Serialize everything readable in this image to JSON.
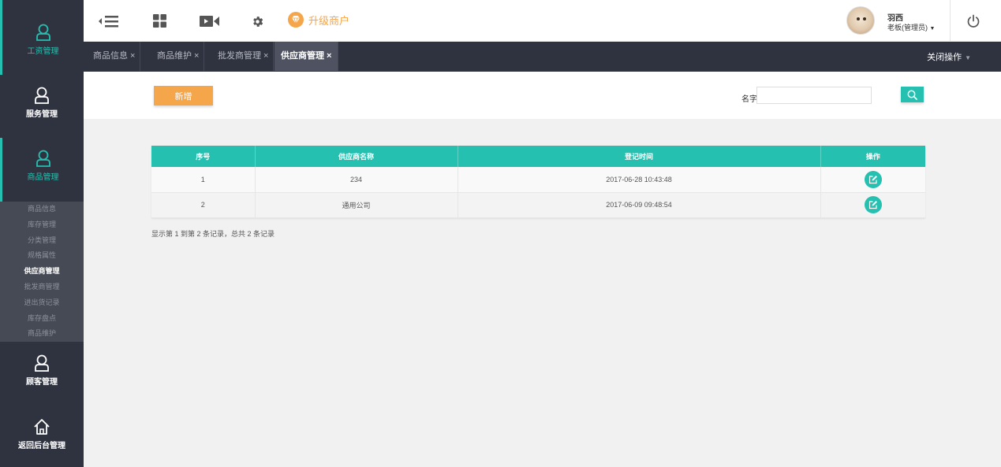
{
  "sidebar": {
    "items": [
      {
        "label": "工资管理",
        "icon": "user-icon"
      },
      {
        "label": "服务管理",
        "icon": "user-icon"
      },
      {
        "label": "商品管理",
        "icon": "user-icon"
      },
      {
        "label": "顾客管理",
        "icon": "user-icon"
      },
      {
        "label": "返回后台管理",
        "icon": "home-icon"
      }
    ],
    "submenu": [
      {
        "label": "商品信息"
      },
      {
        "label": "库存管理"
      },
      {
        "label": "分类管理"
      },
      {
        "label": "规格属性"
      },
      {
        "label": "供应商管理"
      },
      {
        "label": "批发商管理"
      },
      {
        "label": "进出货记录"
      },
      {
        "label": "库存盘点"
      },
      {
        "label": "商品维护"
      }
    ]
  },
  "header": {
    "upgrade_label": "升级商户",
    "user_name": "羽西",
    "user_role": "老板(管理员)",
    "icons": [
      "menu-collapse-icon",
      "grid-icon",
      "video-icon",
      "gear-icon",
      "diamond-icon",
      "power-icon"
    ]
  },
  "tabs": [
    {
      "label": "商品信息 ×"
    },
    {
      "label": "商品维护 ×"
    },
    {
      "label": "批发商管理 ×"
    },
    {
      "label": "供应商管理 ×"
    }
  ],
  "close_ops_label": "关闭操作",
  "toolbar": {
    "add_label": "新增",
    "name_label": "名字:",
    "name_value": ""
  },
  "table": {
    "headers": [
      "序号",
      "供应商名称",
      "登记时间",
      "操作"
    ],
    "rows": [
      {
        "index": "1",
        "name": "234",
        "time": "2017-06-28 10:43:48"
      },
      {
        "index": "2",
        "name": "通用公司",
        "time": "2017-06-09 09:48:54"
      }
    ]
  },
  "pagination_text": "显示第 1 到第 2 条记录，总共 2 条记录",
  "colors": {
    "accent": "#26c0b0",
    "orange": "#f5a54a",
    "sidebar": "#2f3340"
  }
}
